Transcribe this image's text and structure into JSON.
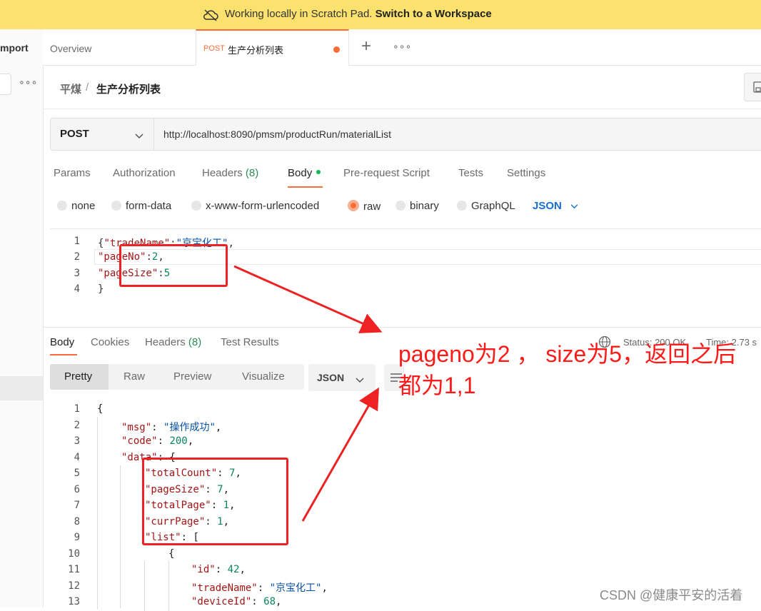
{
  "banner": {
    "message": "Working locally in Scratch Pad.",
    "cta": "Switch to a Workspace"
  },
  "left": {
    "import_label": "mport",
    "more": "∘∘∘"
  },
  "tabs": {
    "overview": "Overview",
    "active_method": "POST",
    "active_name": "生产分析列表",
    "plus": "+",
    "more": "∘∘∘"
  },
  "breadcrumb": {
    "parent": "平煤",
    "sep": "/",
    "current": "生产分析列表"
  },
  "request": {
    "method": "POST",
    "url": "http://localhost:8090/pmsm/productRun/materialList"
  },
  "req_tabs": {
    "params": "Params",
    "authorization": "Authorization",
    "headers": "Headers",
    "headers_count": "(8)",
    "body": "Body",
    "prerequest": "Pre-request Script",
    "tests": "Tests",
    "settings": "Settings"
  },
  "body_types": {
    "none": "none",
    "form_data": "form-data",
    "urlencoded": "x-www-form-urlencoded",
    "raw": "raw",
    "binary": "binary",
    "graphql": "GraphQL",
    "format": "JSON"
  },
  "request_body": {
    "line_numbers": [
      "1",
      "2",
      "3",
      "4"
    ],
    "l1_open": "{",
    "l1_key": "\"tradeName\"",
    "l1_colon": ":",
    "l1_val": "\"京宝化工\"",
    "l1_comma": ",",
    "l2_key": "\"pageNo\"",
    "l2_colon": ":",
    "l2_val": "2",
    "l2_comma": ",",
    "l3_key": "\"pageSize\"",
    "l3_colon": ":",
    "l3_val": "5",
    "l4": "}"
  },
  "response_tabs": {
    "body": "Body",
    "cookies": "Cookies",
    "headers": "Headers",
    "headers_count": "(8)",
    "test_results": "Test Results"
  },
  "response_meta": {
    "status": "Status: 200 OK",
    "time": "Time: 2.73 s"
  },
  "response_views": {
    "pretty": "Pretty",
    "raw": "Raw",
    "preview": "Preview",
    "visualize": "Visualize",
    "format": "JSON"
  },
  "response_body": {
    "line_numbers": [
      "1",
      "2",
      "3",
      "4",
      "5",
      "6",
      "7",
      "8",
      "9",
      "10",
      "11",
      "12",
      "13"
    ],
    "l1": "{",
    "l2_key": "\"msg\"",
    "l2_val": "\"操作成功\"",
    "l3_key": "\"code\"",
    "l3_val": "200",
    "l4_key": "\"data\"",
    "l4_tail": ": {",
    "l5_key": "\"totalCount\"",
    "l5_val": "7",
    "l6_key": "\"pageSize\"",
    "l6_val": "7",
    "l7_key": "\"totalPage\"",
    "l7_val": "1",
    "l8_key": "\"currPage\"",
    "l8_val": "1",
    "l9_key": "\"list\"",
    "l9_tail": ": [",
    "l10": "{",
    "l11_key": "\"id\"",
    "l11_val": "42",
    "l12_key": "\"tradeName\"",
    "l12_val": "\"京宝化工\"",
    "l13_key": "\"deviceId\"",
    "l13_val": "68"
  },
  "annotation": {
    "line1": "pageno为2 ， size为5，返回之后",
    "line2": "都为1,1"
  },
  "watermark": "CSDN @健康平安的活着",
  "colors": {
    "accent": "#ff6c37",
    "banner": "#fbe26f",
    "annotation": "#ff1a1a",
    "json_key": "#a31515",
    "json_string": "#0451a5",
    "json_number": "#098658"
  }
}
